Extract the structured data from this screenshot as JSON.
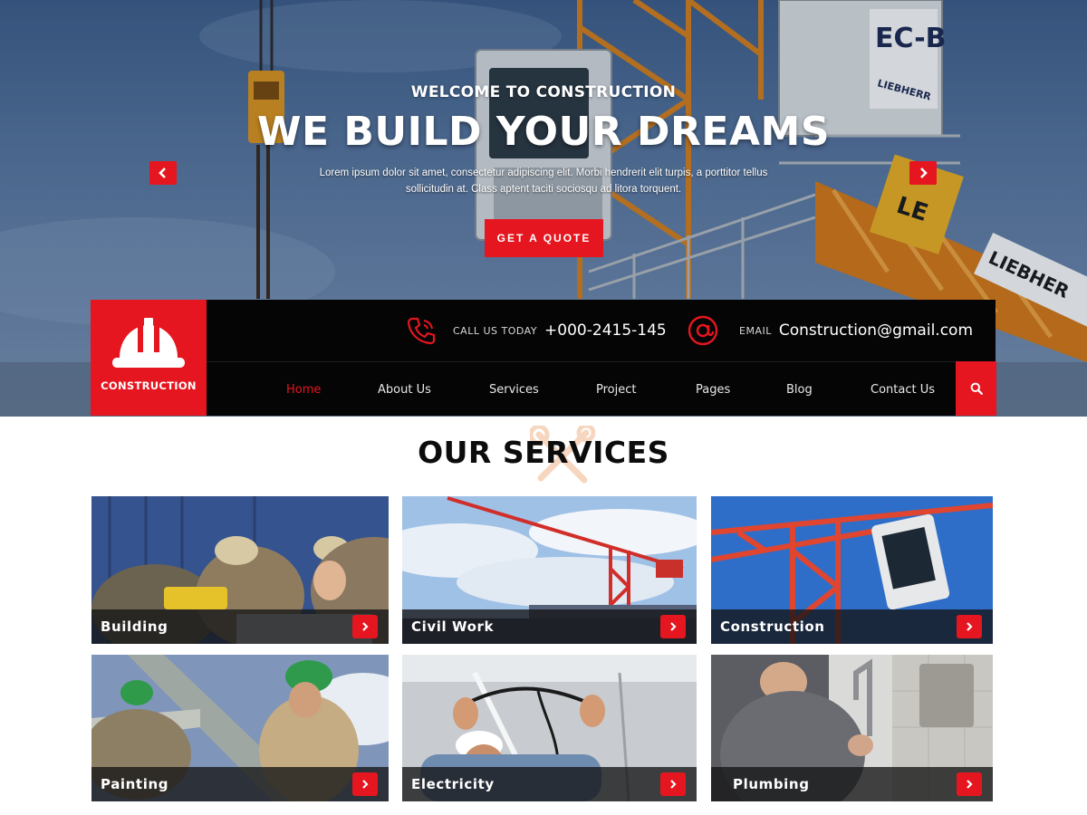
{
  "hero": {
    "pretitle": "WELCOME TO CONSTRUCTION",
    "title": "WE BUILD YOUR DREAMS",
    "description": "Lorem ipsum dolor sit amet, consectetur adipiscing elit. Morbi hendrerit elit turpis, a porttitor tellus sollicitudin at. Class aptent taciti sociosqu ad litora torquent.",
    "cta_label": "GET A QUOTE",
    "prev_icon": "chevron-left-icon",
    "next_icon": "chevron-right-icon",
    "crane_text": {
      "cab_brand": "EC-B",
      "cab_maker": "LIEBHERR",
      "sign_letters": "LE",
      "jib_text": "LIEBHER"
    }
  },
  "header": {
    "logo_text": "CONSTRUCTION",
    "logo_icon": "hard-hat-icon",
    "phone": {
      "label": "CALL US TODAY",
      "value": "+000-2415-145",
      "icon": "phone-icon"
    },
    "email": {
      "label": "EMAIL",
      "value": "Construction@gmail.com",
      "icon": "at-sign-icon"
    },
    "nav": [
      {
        "label": "Home",
        "active": true
      },
      {
        "label": "About Us"
      },
      {
        "label": "Services"
      },
      {
        "label": "Project"
      },
      {
        "label": "Pages"
      },
      {
        "label": "Blog"
      },
      {
        "label": "Contact Us"
      }
    ],
    "search_icon": "search-icon"
  },
  "services": {
    "title": "OUR SERVICES",
    "decor_icon": "tools-icon",
    "cards": [
      {
        "label": "Building"
      },
      {
        "label": "Civil Work"
      },
      {
        "label": "Construction"
      },
      {
        "label": "Painting"
      },
      {
        "label": "Electricity"
      },
      {
        "label": "Plumbing"
      }
    ]
  },
  "colors": {
    "accent": "#e5161f",
    "header_bg": "#050505",
    "text_dark": "#0c0c0c"
  }
}
